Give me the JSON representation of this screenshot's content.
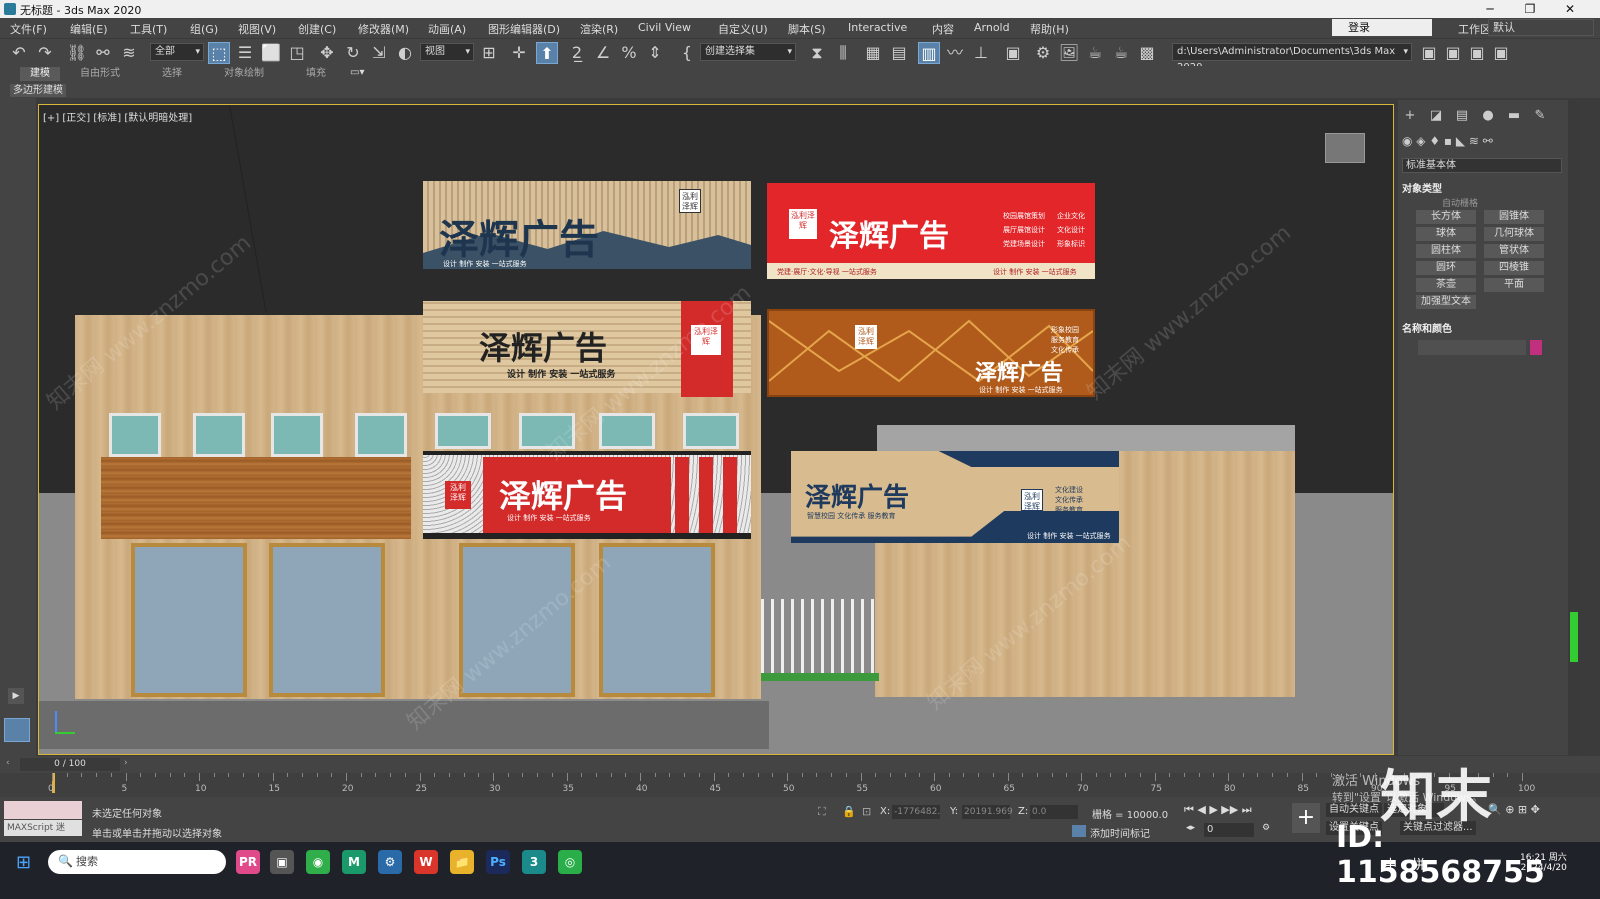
{
  "titlebar": {
    "title": "无标题 - 3ds Max 2020",
    "minimize": "─",
    "maximize": "❐",
    "close": "✕"
  },
  "menus": [
    "文件(F)",
    "编辑(E)",
    "工具(T)",
    "组(G)",
    "视图(V)",
    "创建(C)",
    "修改器(M)",
    "动画(A)",
    "图形编辑器(D)",
    "渲染(R)",
    "Civil View",
    "自定义(U)",
    "脚本(S)",
    "Interactive",
    "内容",
    "Arnold",
    "帮助(H)"
  ],
  "login": "登录",
  "workspace": {
    "label": "工作区:",
    "value": "默认"
  },
  "toolbar": {
    "filter": "全部",
    "refcoord": "视图",
    "selset": "创建选择集",
    "path": "d:\\Users\\Administrator\\Documents\\3ds Max 2020"
  },
  "ribbon_tabs": [
    "建模",
    "自由形式",
    "选择",
    "对象绘制",
    "填充"
  ],
  "ribbon_sub": "多边形建模",
  "viewport": {
    "label": "[+] [正交] [标准] [默认明暗处理]",
    "signs": {
      "brand": "泽辉广告",
      "seal": "泓利泽辉",
      "tagline": "设计 制作 安装 一站式服务",
      "red_lines": [
        "校园展馆策划",
        "企业文化",
        "展厅展馆设计",
        "文化设计",
        "党建场景设计",
        "形象标识"
      ],
      "red_bottom": "党建·展厅·文化·导视 一站式服务",
      "orange_lines": [
        "形象校园",
        "服务教育",
        "文化传承"
      ],
      "blue_lines": [
        "文化建设",
        "文化传承",
        "服务教育"
      ],
      "blue_sub": "智慧校园   文化传承   服务教育"
    }
  },
  "right_panel": {
    "tabs": [
      "+",
      "◪",
      "▤",
      "●",
      "▬",
      "✎"
    ],
    "dropdown": "标准基本体",
    "section1": "对象类型",
    "autogrid": "自动栅格",
    "buttons": [
      "长方体",
      "圆锥体",
      "球体",
      "几何球体",
      "圆柱体",
      "管状体",
      "圆环",
      "四棱锥",
      "茶壶",
      "平面",
      "加强型文本"
    ],
    "section2": "名称和颜色",
    "color": "#c0307e"
  },
  "timeline": {
    "frame": "0 / 100",
    "ticks": [
      "0",
      "5",
      "10",
      "15",
      "20",
      "25",
      "30",
      "35",
      "40",
      "45",
      "50",
      "55",
      "60",
      "65",
      "70",
      "75",
      "80",
      "85",
      "90",
      "95",
      "100"
    ]
  },
  "status": {
    "maxscript_placeholder": "MAXScript 迷",
    "line1": "未选定任何对象",
    "line2": "单击或单击并拖动以选择对象",
    "x_label": "X:",
    "x": "-1776482.",
    "y_label": "Y:",
    "y": "20191.969",
    "z_label": "Z:",
    "z": "0.0",
    "grid": "栅格 = 10000.0",
    "addtime": "添加时间标记",
    "autokey": "自动关键点",
    "setkey": "设置关键点",
    "selected": "选定对象",
    "keyfilter": "关键点过滤器...",
    "spinner": "0"
  },
  "taskbar": {
    "search": "搜索",
    "apps": [
      "PR",
      "▣",
      "◉",
      "M",
      "⚙",
      "W",
      "📁",
      "Ps",
      "3",
      "◎"
    ],
    "time": "16:21 周六",
    "date": "2024/4/20",
    "ime1": "中",
    "ime2": "拼"
  },
  "overlay": {
    "brand": "知末",
    "id": "ID: 1158568755",
    "activate1": "激活 Windows",
    "activate2": "转到\"设置\"以激活 Windows。",
    "watermark": "知末网 www.znzmo.com"
  }
}
